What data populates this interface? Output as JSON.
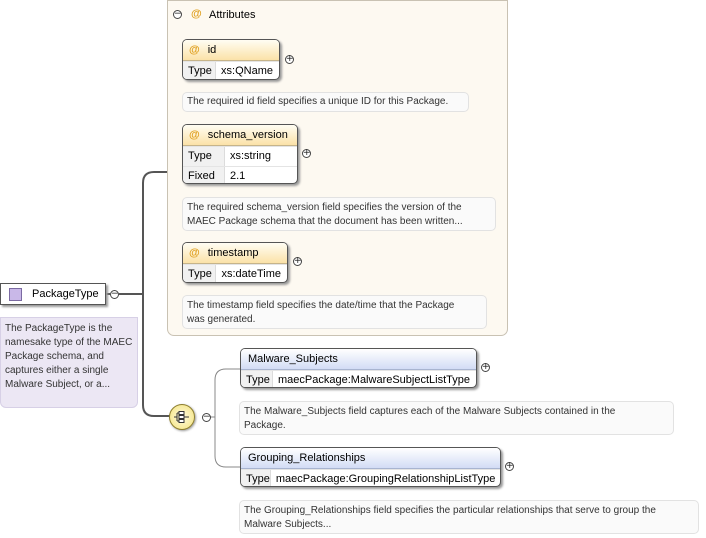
{
  "attributes_panel": {
    "title": "Attributes"
  },
  "attributes": [
    {
      "name": "id",
      "rows": [
        {
          "key": "Type",
          "value": "xs:QName"
        }
      ],
      "description": "The required id field specifies a unique ID for this Package."
    },
    {
      "name": "schema_version",
      "rows": [
        {
          "key": "Type",
          "value": "xs:string"
        },
        {
          "key": "Fixed",
          "value": "2.1"
        }
      ],
      "description_line1": "The required schema_version field specifies the version of the",
      "description_line2": "MAEC Package schema that the document has been written..."
    },
    {
      "name": "timestamp",
      "rows": [
        {
          "key": "Type",
          "value": "xs:dateTime"
        }
      ],
      "description_line1": "The timestamp field specifies the date/time that the Package",
      "description_line2": "was generated."
    }
  ],
  "root": {
    "name": "PackageType",
    "description": "The PackageType is the namesake type of the MAEC Package schema, and captures either a single Malware Subject, or a..."
  },
  "elements": [
    {
      "name": "Malware_Subjects",
      "rows": [
        {
          "key": "Type",
          "value": "maecPackage:MalwareSubjectListType"
        }
      ],
      "description_line1": "The Malware_Subjects field captures each of the Malware Subjects contained in the",
      "description_line2": "Package."
    },
    {
      "name": "Grouping_Relationships",
      "rows": [
        {
          "key": "Type",
          "value": "maecPackage:GroupingRelationshipListType"
        }
      ],
      "description_line1": "The Grouping_Relationships field specifies the particular relationships that serve to group the",
      "description_line2": "Malware Subjects..."
    }
  ],
  "symbols": {
    "at": "@",
    "collapse": "−",
    "expand": "+"
  },
  "colors": {
    "attribute_header": "#fbe2a8",
    "element_header": "#d2dcf5",
    "root_icon": "#c9b8e8",
    "compositor": "#f3e27a"
  }
}
